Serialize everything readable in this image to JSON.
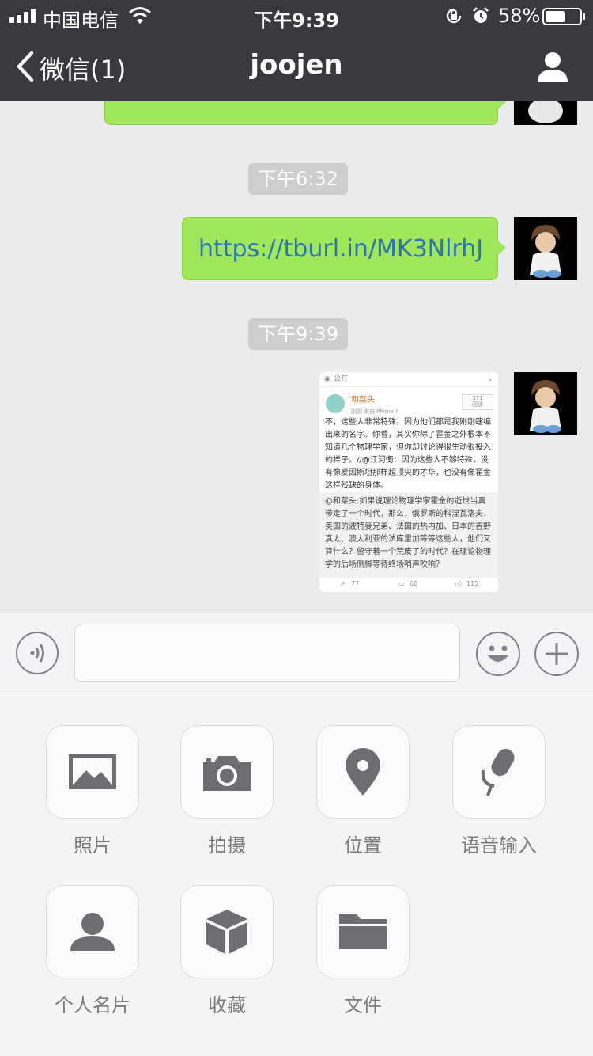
{
  "status_bar": {
    "carrier": "中国电信",
    "time": "下午9:39",
    "battery": "58%",
    "battery_level": 0.58
  },
  "navbar": {
    "back_label": "微信(1)",
    "title": "joojen"
  },
  "chat": {
    "messages": [
      {
        "type": "time",
        "text": "下午6:32"
      },
      {
        "type": "text",
        "text": "https://tburl.in/MK3NlrhJ"
      },
      {
        "type": "time",
        "text": "下午9:39"
      }
    ],
    "screenshot": {
      "header": "公开",
      "user": "和菜头",
      "meta": "刚刚  来自iPhone X",
      "reads": "571\n阅读",
      "body": "不，这些人非常特殊，因为他们都是我刚刚瞎编出来的名字。你看，其实你除了霍金之外根本不知道几个物理学家，但你却讨论得很生动很投入的样子。//@江河衡：因为这些人不够特殊，没有像爱因斯坦那样超顶尖的才华，也没有像霍金这样残缺的身体。",
      "repost": "@和菜头:如果说理论物理学家霍金的逝世当真带走了一个时代，那么，俄罗斯的科涅瓦洛夫、美国的波特曼兄弟、法国的热内加、日本的吉野真太、澳大利亚的法库里加等等这些人，他们又算什么？留守着一个荒废了的时代？在理论物理学的后场侧脚等待终场哨声吹响？",
      "shares": "77",
      "comments": "60",
      "likes": "115"
    }
  },
  "panel": {
    "items": [
      {
        "label": "照片",
        "icon": "photo-icon"
      },
      {
        "label": "拍摄",
        "icon": "camera-icon"
      },
      {
        "label": "位置",
        "icon": "location-icon"
      },
      {
        "label": "语音输入",
        "icon": "microphone-icon"
      },
      {
        "label": "个人名片",
        "icon": "contact-card-icon"
      },
      {
        "label": "收藏",
        "icon": "favorites-box-icon"
      },
      {
        "label": "文件",
        "icon": "folder-icon"
      }
    ]
  },
  "colors": {
    "navbar": "#38393d",
    "chat_bg": "#ebebeb",
    "bubble": "#a0e75a",
    "link": "#2d73b8",
    "panel": "#f4f4f6"
  }
}
